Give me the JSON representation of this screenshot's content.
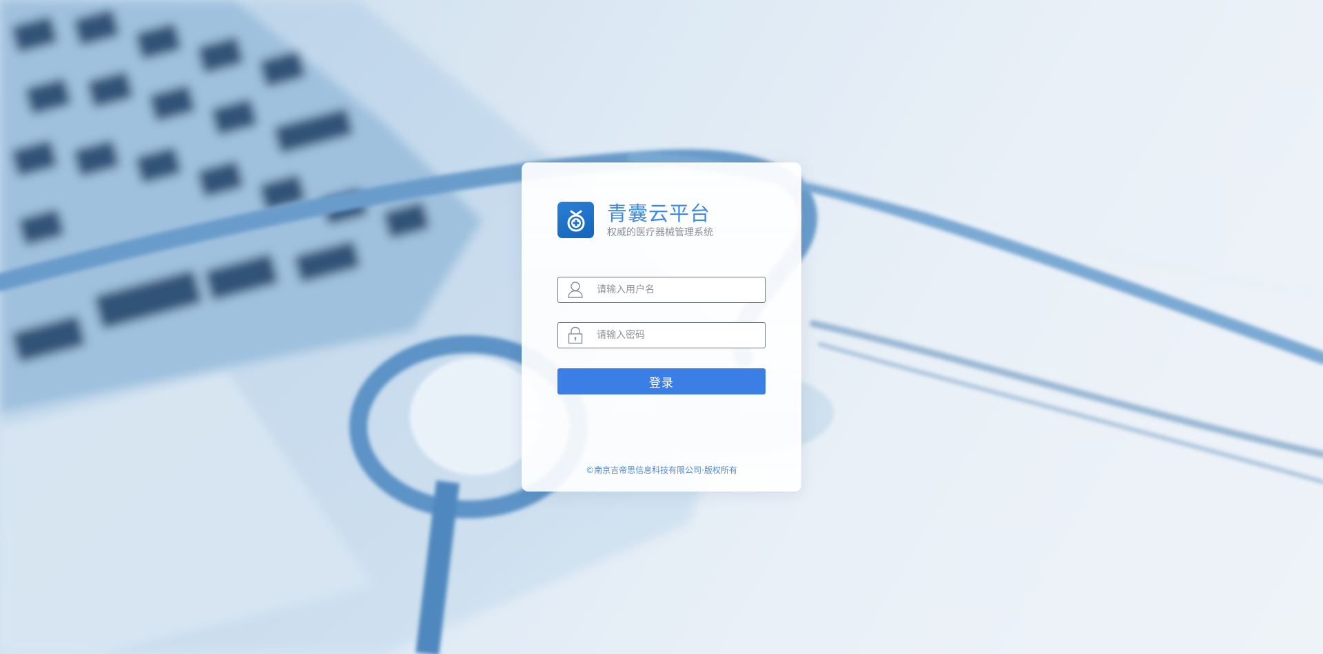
{
  "brand": {
    "title": "青囊云平台",
    "subtitle": "权威的医疗器械管理系统",
    "logo_icon": "medical-bag-logo-icon",
    "color": "#3f8ae0"
  },
  "login_form": {
    "username": {
      "placeholder": "请输入用户名",
      "value": "",
      "icon": "user-icon"
    },
    "password": {
      "placeholder": "请输入密码",
      "value": "",
      "icon": "lock-icon"
    },
    "submit_label": "登录",
    "accent_color": "#3b7fe6"
  },
  "footer": {
    "copyright": "©南京吉帝思信息科技有限公司·版权所有"
  }
}
